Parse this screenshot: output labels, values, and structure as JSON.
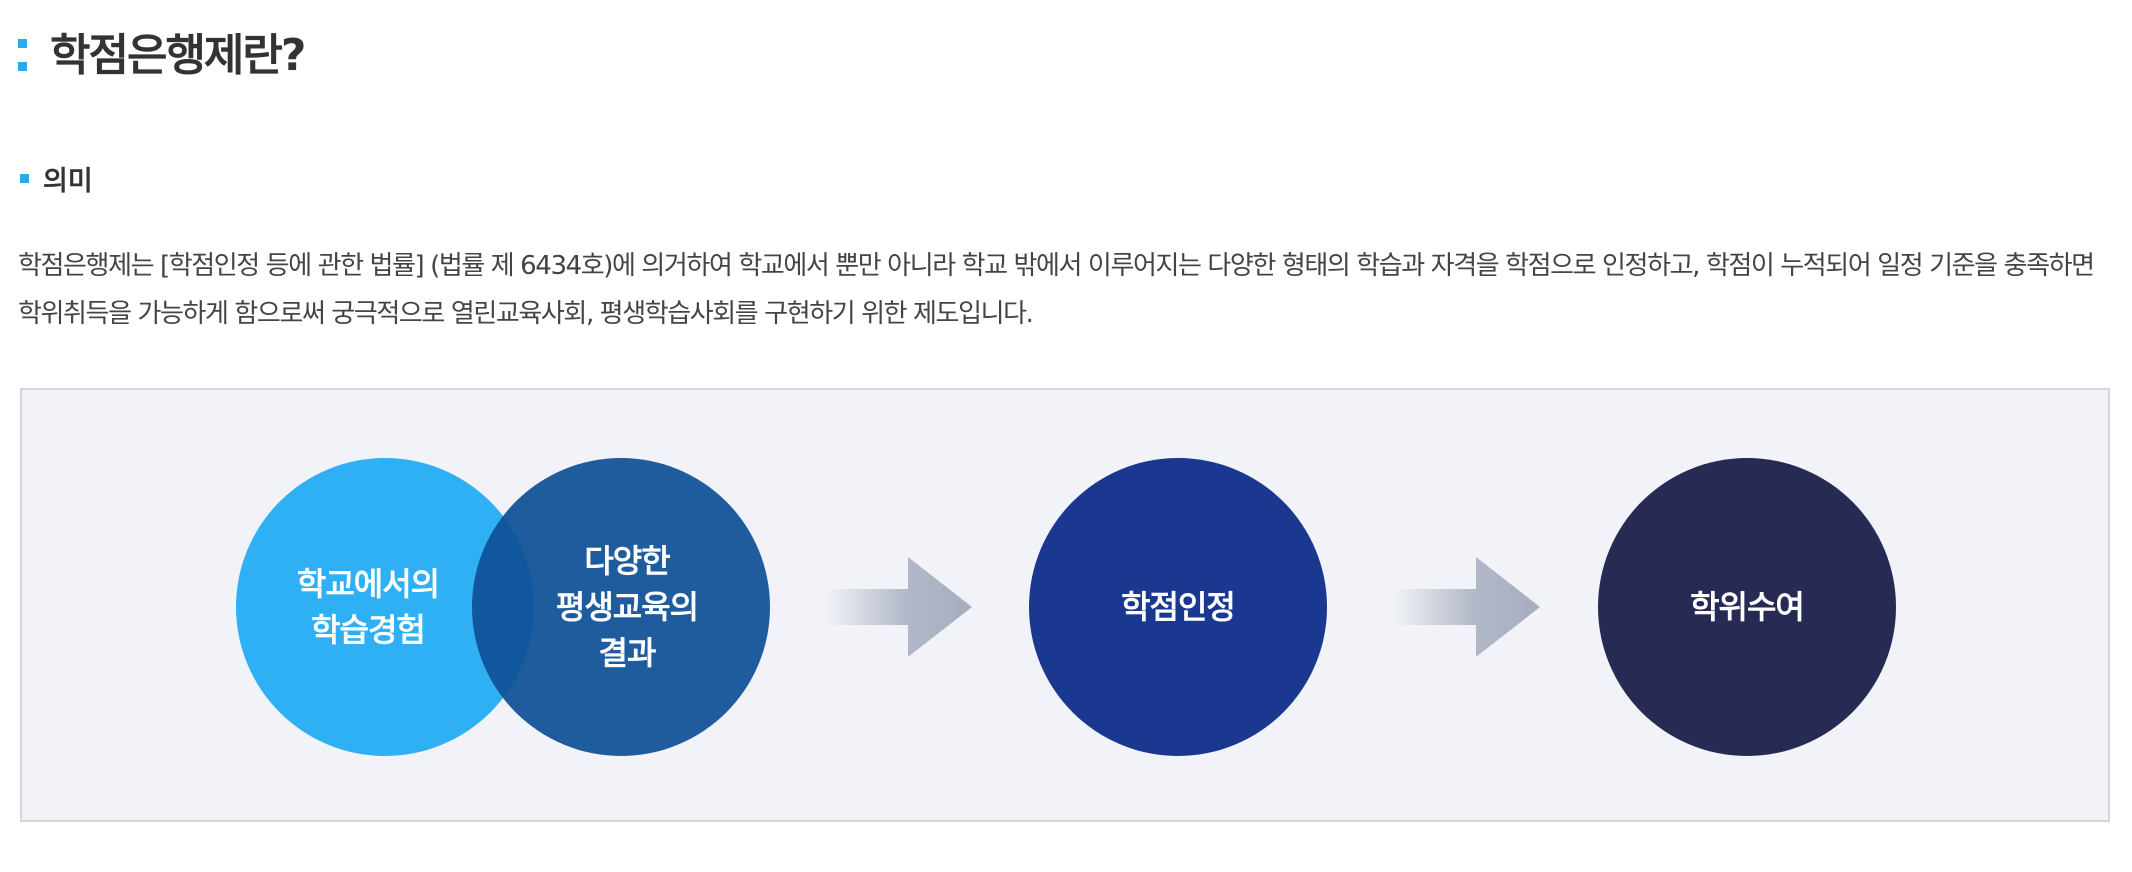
{
  "header": {
    "title": "학점은행제란?"
  },
  "section": {
    "heading": "의미",
    "description": "학점은행제는 [학점인정 등에 관한 법률] (법률 제 6434호)에 의거하여 학교에서 뿐만 아니라 학교 밖에서 이루어지는 다양한 형태의 학습과 자격을 학점으로 인정하고, 학점이 누적되어 일정 기준을 충족하면 학위취득을 가능하게 함으로써 궁극적으로 열린교육사회, 평생학습사회를 구현하기 위한 제도입니다."
  },
  "diagram": {
    "circles": [
      {
        "label": "학교에서의\n학습경험",
        "color": "#2fb0f5"
      },
      {
        "label": "다양한\n평생교육의\n결과",
        "color": "#0f5096"
      },
      {
        "label": "학점인정",
        "color": "#1b3891"
      },
      {
        "label": "학위수여",
        "color": "#272a52"
      }
    ],
    "arrow_icon": "arrow-right-icon"
  },
  "colors": {
    "accent": "#2aaae8",
    "diagram_background": "#f1f3f8",
    "arrow": "#a6aebf"
  }
}
